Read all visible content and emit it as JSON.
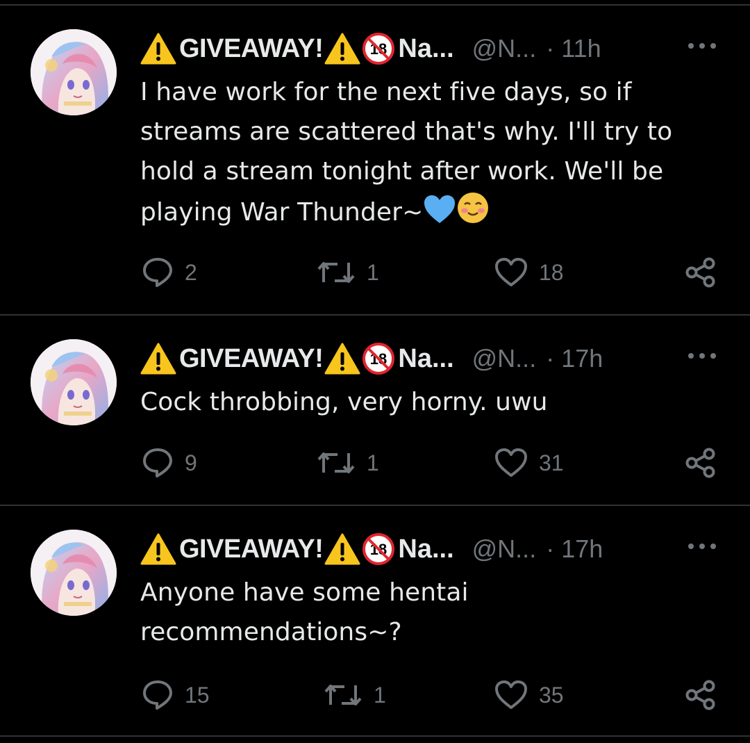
{
  "tweets": [
    {
      "display_name": "GIVEAWAY!",
      "name_truncated": "Na...",
      "handle": "@N...",
      "dot": "·",
      "time": "11h",
      "text": "I have work for the next five days, so if streams are scattered that's why. I'll try to hold a stream tonight after work. We'll be playing War Thunder~",
      "replies": "2",
      "retweets": "1",
      "likes": "18"
    },
    {
      "display_name": "GIVEAWAY!",
      "name_truncated": "Na...",
      "handle": "@N...",
      "dot": "·",
      "time": "17h",
      "text": "Cock throbbing, very horny. uwu",
      "replies": "9",
      "retweets": "1",
      "likes": "31"
    },
    {
      "display_name": "GIVEAWAY!",
      "name_truncated": "Na...",
      "handle": "@N...",
      "dot": "·",
      "time": "17h",
      "text": "Anyone have some hentai recommendations~?",
      "replies": "15",
      "retweets": "1",
      "likes": "35"
    }
  ],
  "badge_text": "18",
  "icons": {
    "warning": "warning-icon",
    "no18": "no-under-18-icon",
    "more": "more-icon",
    "reply": "reply-icon",
    "retweet": "retweet-icon",
    "like": "like-icon",
    "share": "share-icon",
    "blue_heart": "blue-heart-emoji",
    "smile": "smiling-blush-emoji"
  },
  "colors": {
    "background": "#000000",
    "text": "#e7e9ea",
    "secondary": "#71767b",
    "divider": "#2f3336",
    "warning": "#f7c51d",
    "no18_red": "#e0262f"
  }
}
